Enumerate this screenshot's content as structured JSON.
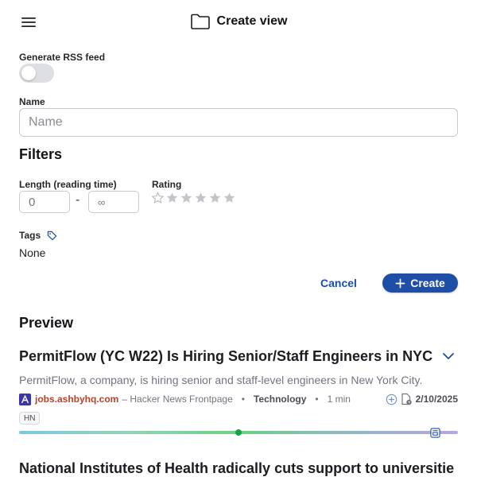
{
  "header": {
    "title": "Create view",
    "menu_icon": "hamburger-menu-icon",
    "title_icon": "folder-icon"
  },
  "form": {
    "rss_label": "Generate RSS feed",
    "rss_enabled": false,
    "name_label": "Name",
    "name_placeholder": "Name",
    "name_value": ""
  },
  "filters": {
    "heading": "Filters",
    "length_label": "Length (reading time)",
    "length_min_placeholder": "0",
    "length_separator": "-",
    "length_max_placeholder": "∞",
    "rating_label": "Rating",
    "rating_value": 0,
    "rating_max": 5,
    "tags_label": "Tags",
    "tags_icon": "tag-icon",
    "tags_value": "None"
  },
  "actions": {
    "cancel_label": "Cancel",
    "create_label": "Create",
    "create_icon": "plus-icon"
  },
  "preview": {
    "heading": "Preview",
    "articles": [
      {
        "title": "PermitFlow (YC W22) Is Hiring Senior/Staff Engineers in NYC",
        "summary": "PermitFlow, a company, is hiring senior and staff-level engineers in New York City.",
        "domain": "jobs.ashbyhq.com",
        "source": "– Hacker News Frontpage",
        "category": "Technology",
        "reading_time": "1 min",
        "date": "2/10/2025",
        "badge": "HN",
        "progress": 0.5
      },
      {
        "title": "National Institutes of Health radically cuts support to universitie"
      }
    ]
  },
  "colors": {
    "accent": "#1e4ea6",
    "domain_link": "#b4432a",
    "progress_dot": "#16a34a"
  }
}
